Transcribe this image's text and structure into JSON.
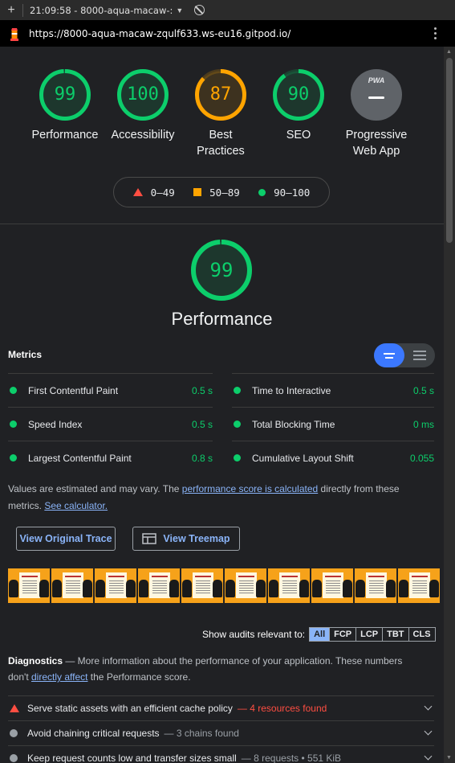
{
  "browser": {
    "tab_title": "21:09:58 - 8000-aqua-macaw-:",
    "url": "https://8000-aqua-macaw-zqulf633.ws-eu16.gitpod.io/"
  },
  "categories": [
    {
      "label_line1": "Performance",
      "label_line2": "",
      "score": "99",
      "color": "#0cce6b",
      "fill": 0.99
    },
    {
      "label_line1": "Accessibility",
      "label_line2": "",
      "score": "100",
      "color": "#0cce6b",
      "fill": 1.0
    },
    {
      "label_line1": "Best",
      "label_line2": "Practices",
      "score": "87",
      "color": "#ffa400",
      "fill": 0.87
    },
    {
      "label_line1": "SEO",
      "label_line2": "",
      "score": "90",
      "color": "#0cce6b",
      "fill": 0.9
    },
    {
      "label_line1": "Progressive",
      "label_line2": "Web App",
      "score": "",
      "badge": "PWA",
      "color": "#9aa0a6"
    }
  ],
  "legend": {
    "fail": "0–49",
    "average": "50–89",
    "pass": "90–100"
  },
  "performance": {
    "score": "99",
    "title": "Performance",
    "fill": 0.99
  },
  "metrics": {
    "header": "Metrics",
    "items": [
      {
        "name": "First Contentful Paint",
        "value": "0.5 s"
      },
      {
        "name": "Time to Interactive",
        "value": "0.5 s"
      },
      {
        "name": "Speed Index",
        "value": "0.5 s"
      },
      {
        "name": "Total Blocking Time",
        "value": "0 ms"
      },
      {
        "name": "Largest Contentful Paint",
        "value": "0.8 s"
      },
      {
        "name": "Cumulative Layout Shift",
        "value": "0.055"
      }
    ]
  },
  "note": {
    "part1": "Values are estimated and may vary. The ",
    "link1": "performance score is calculated",
    "part2": " directly from these metrics. ",
    "link2": "See calculator."
  },
  "buttons": {
    "trace": "View Original Trace",
    "treemap": "View Treemap"
  },
  "filter": {
    "label": "Show audits relevant to:",
    "options": [
      "All",
      "FCP",
      "LCP",
      "TBT",
      "CLS"
    ]
  },
  "diagnostics": {
    "title": "Diagnostics",
    "desc1": " — More information about the performance of your application. These numbers don't ",
    "link": "directly affect",
    "desc2": " the Performance score."
  },
  "audits": [
    {
      "title": "Serve static assets with an efficient cache policy",
      "sub": "— 4 resources found",
      "status": "fail"
    },
    {
      "title": "Avoid chaining critical requests",
      "sub": "— 3 chains found",
      "status": "info"
    },
    {
      "title": "Keep request counts low and transfer sizes small",
      "sub": "— 8 requests • 551 KiB",
      "status": "info"
    }
  ]
}
